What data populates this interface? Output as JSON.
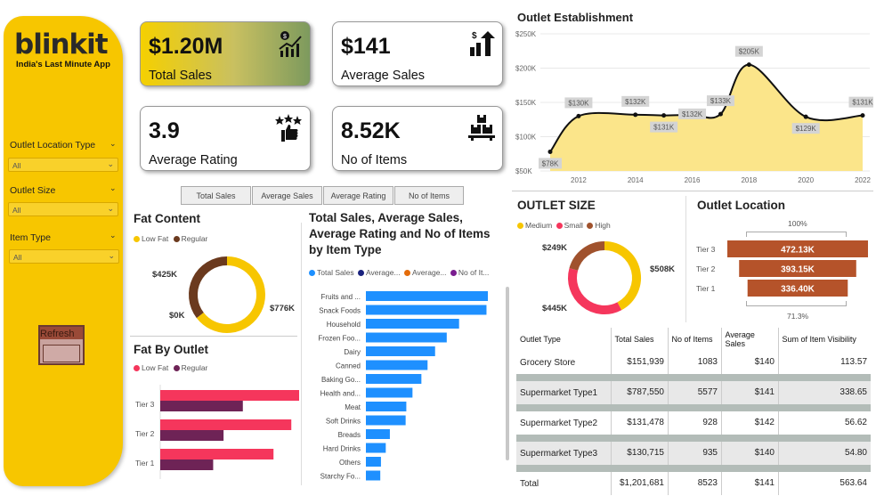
{
  "brand": {
    "logo": "blinkit",
    "tagline": "India's Last Minute App"
  },
  "filters": [
    {
      "label": "Outlet Location Type",
      "value": "All"
    },
    {
      "label": "Outlet Size",
      "value": "All"
    },
    {
      "label": "Item Type",
      "value": "All"
    }
  ],
  "refresh_label": "Refresh",
  "kpis": [
    {
      "value": "$1.20M",
      "label": "Total Sales",
      "icon": "sales-chart-icon"
    },
    {
      "value": "$141",
      "label": "Average Sales",
      "icon": "dollar-growth-icon"
    },
    {
      "value": "3.9",
      "label": "Average Rating",
      "icon": "thumbs-up-stars-icon"
    },
    {
      "value": "8.52K",
      "label": "No of Items",
      "icon": "boxes-icon"
    }
  ],
  "tabs": [
    "Total Sales",
    "Average Sales",
    "Average Rating",
    "No of Items"
  ],
  "fat_content": {
    "title": "Fat Content",
    "legend": [
      "Low Fat",
      "Regular"
    ],
    "colors": {
      "low_fat": "#f7c600",
      "regular": "#6b3a1e"
    },
    "chart_data": {
      "type": "pie",
      "labels": [
        "Low Fat",
        "Regular"
      ],
      "values": [
        776,
        425
      ],
      "value_labels": [
        "$776K",
        "$425K"
      ],
      "zero_label": "$0K"
    }
  },
  "fat_by_outlet": {
    "title": "Fat By Outlet",
    "legend": [
      "Low Fat",
      "Regular"
    ],
    "colors": {
      "low_fat": "#f5365c",
      "regular": "#6e2356"
    },
    "chart_data": {
      "type": "bar",
      "categories": [
        "Tier 3",
        "Tier 2",
        "Tier 1"
      ],
      "series": [
        {
          "name": "Low Fat",
          "values": [
            306,
            265,
            229
          ]
        },
        {
          "name": "Regular",
          "values": [
            167,
            128,
            107
          ]
        }
      ]
    }
  },
  "item_type": {
    "title": "Total Sales, Average Sales, Average Rating and No of Items by Item Type",
    "legend": [
      "Total Sales",
      "Average...",
      "Average...",
      "No of It..."
    ],
    "legend_colors": [
      "#1e90ff",
      "#1a237e",
      "#e46c0a",
      "#7a1d8f"
    ],
    "chart_data": {
      "type": "bar",
      "categories": [
        "Fruits and ...",
        "Snack Foods",
        "Household",
        "Frozen Foo...",
        "Dairy",
        "Canned",
        "Baking Go...",
        "Health and...",
        "Meat",
        "Soft Drinks",
        "Breads",
        "Hard Drinks",
        "Others",
        "Starchy Fo..."
      ],
      "values": [
        178,
        176,
        136,
        118,
        101,
        90,
        81,
        68,
        59,
        58,
        35,
        29,
        22,
        21
      ]
    }
  },
  "outlet_establishment": {
    "title": "Outlet Establishment",
    "chart_data": {
      "type": "area",
      "x": [
        2011,
        2012,
        2014,
        2015,
        2016,
        2017,
        2018,
        2020,
        2022
      ],
      "values": [
        78,
        130,
        132,
        131,
        132,
        133,
        205,
        129,
        131
      ],
      "value_labels": [
        "$78K",
        "$130K",
        "$132K",
        "$131K",
        "$132K",
        "$133K",
        "$205K",
        "$129K",
        "$131K"
      ],
      "y_ticks": [
        "$250K",
        "$200K",
        "$150K",
        "$100K",
        "$50K"
      ],
      "x_ticks": [
        "2012",
        "2014",
        "2016",
        "2018",
        "2020",
        "2022"
      ],
      "ylim": [
        50,
        250
      ]
    }
  },
  "outlet_size": {
    "title": "OUTLET SIZE",
    "legend": [
      "Medium",
      "Small",
      "High"
    ],
    "colors": {
      "medium": "#f7c600",
      "small": "#f5365c",
      "high": "#a0522d"
    },
    "chart_data": {
      "type": "pie",
      "labels": [
        "Medium",
        "Small",
        "High"
      ],
      "values": [
        508,
        445,
        249
      ],
      "value_labels": [
        "$508K",
        "$445K",
        "$249K"
      ]
    }
  },
  "outlet_location": {
    "title": "Outlet Location",
    "top_pct": "100%",
    "bottom_pct": "71.3%",
    "color": "#b5532a",
    "chart_data": {
      "type": "bar",
      "categories": [
        "Tier 3",
        "Tier 2",
        "Tier 1"
      ],
      "values": [
        472.13,
        393.15,
        336.4
      ],
      "value_labels": [
        "472.13K",
        "393.15K",
        "336.40K"
      ]
    }
  },
  "outlet_table": {
    "headers": [
      "Outlet Type",
      "Total Sales",
      "No of Items",
      "Average Sales",
      "Sum of Item Visibility"
    ],
    "rows": [
      [
        "Grocery Store",
        "$151,939",
        "1083",
        "$140",
        "113.57"
      ],
      [
        "Supermarket Type1",
        "$787,550",
        "5577",
        "$141",
        "338.65"
      ],
      [
        "Supermarket Type2",
        "$131,478",
        "928",
        "$142",
        "56.62"
      ],
      [
        "Supermarket Type3",
        "$130,715",
        "935",
        "$140",
        "54.80"
      ]
    ],
    "total": [
      "Total",
      "$1,201,681",
      "8523",
      "$141",
      "563.64"
    ]
  }
}
